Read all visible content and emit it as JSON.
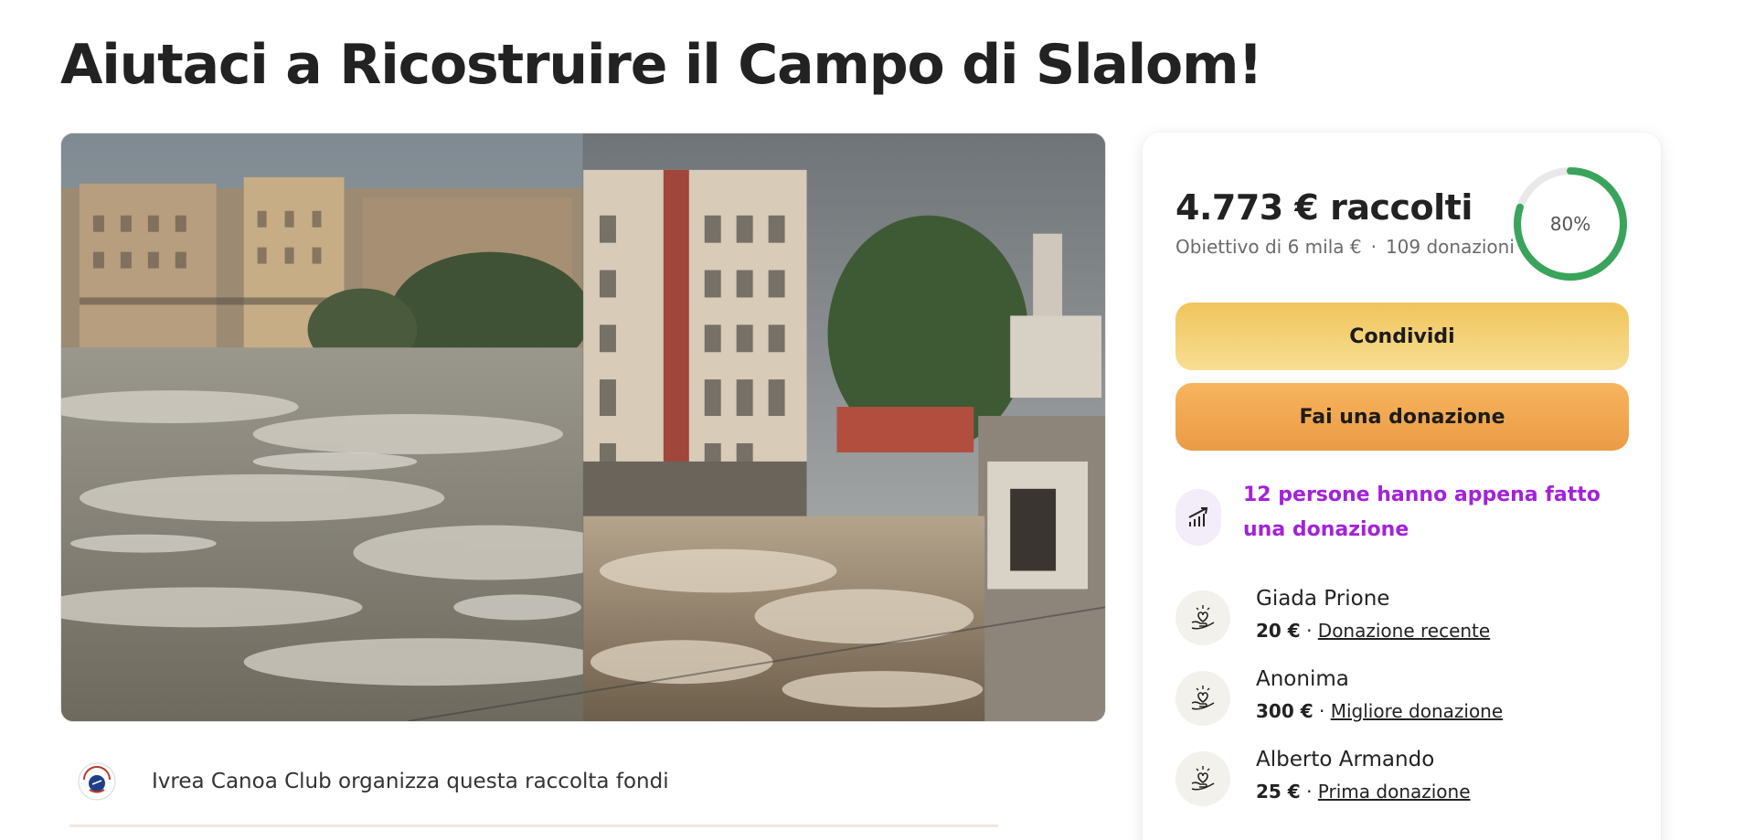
{
  "page_title": "Aiutaci a Ricostruire il Campo di Slalom!",
  "hero": {
    "image_alt_icon": "flood-river-photo"
  },
  "organizer": {
    "text": "Ivrea Canoa Club organizza questa raccolta fondi",
    "logo_icon": "club-logo-icon"
  },
  "summary": {
    "raised": "4.773 € raccolti",
    "goal": "Obiettivo di 6 mila €",
    "separator": "·",
    "donations": "109 donazioni",
    "progress_label": "80%",
    "progress_fraction": 0.8,
    "progress_color": "#3aa45b",
    "progress_track_color": "#e9e9e9"
  },
  "actions": {
    "share_label": "Condividi",
    "donate_label": "Fai una donazione"
  },
  "recent_banner": {
    "text": "12 persone hanno appena fatto una donazione",
    "icon": "trending-up-icon",
    "color": "#a322d8"
  },
  "donors": [
    {
      "name": "Giada Prione",
      "amount": "20 €",
      "sep": " · ",
      "tag": "Donazione recente",
      "icon": "heart-hand-icon"
    },
    {
      "name": "Anonima",
      "amount": "300 €",
      "sep": " · ",
      "tag": "Migliore donazione",
      "icon": "heart-hand-icon"
    },
    {
      "name": "Alberto Armando",
      "amount": "25 €",
      "sep": " · ",
      "tag": "Prima donazione",
      "icon": "heart-hand-icon"
    }
  ]
}
